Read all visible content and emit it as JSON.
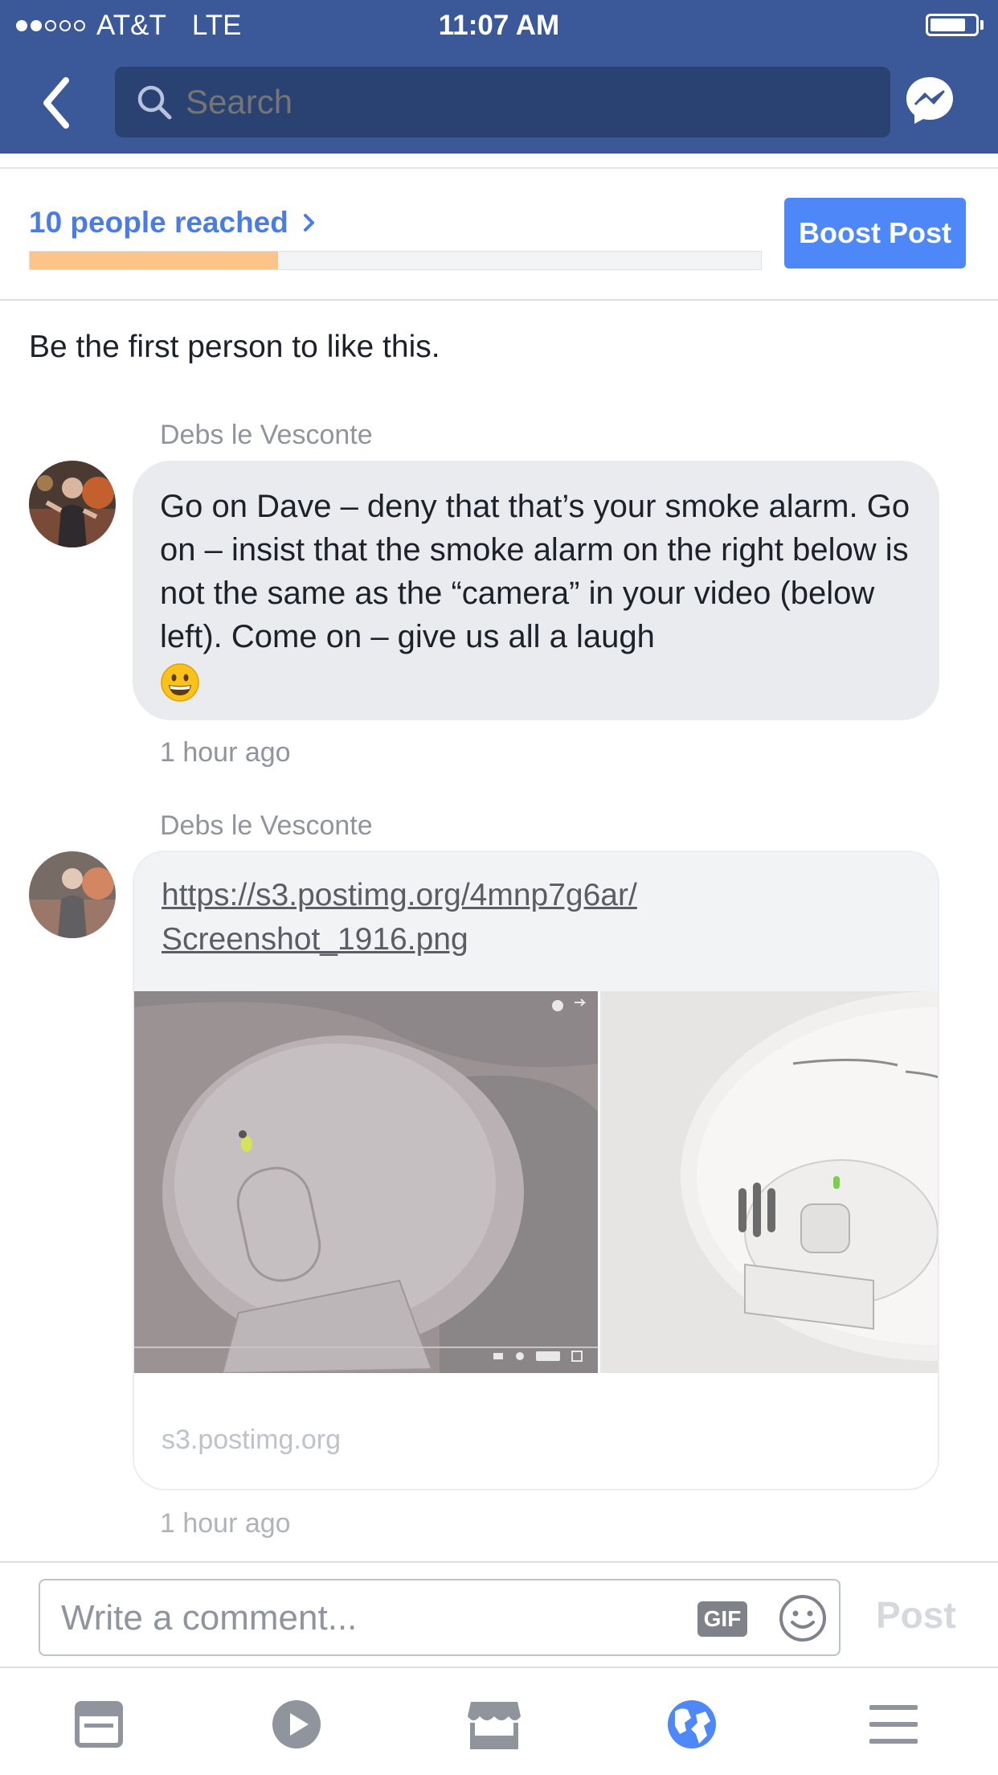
{
  "status_bar": {
    "signal_bars_filled": 2,
    "signal_bars_total": 5,
    "carrier": "AT&T",
    "network": "LTE",
    "time": "11:07 AM",
    "battery_level": 0.8
  },
  "nav": {
    "back_icon": "chevron-left-icon",
    "search_placeholder": "Search",
    "messenger_icon": "messenger-icon"
  },
  "reach": {
    "label": "10 people reached",
    "progress_fraction": 0.34,
    "progress_color": "#fcc489",
    "boost_label": "Boost Post"
  },
  "likes_text": "Be the first person to like this.",
  "comments": [
    {
      "author": "Debs le Vesconte",
      "text": "Go on Dave – deny that that’s your smoke alarm. Go on – insist that the smoke alarm on the right below is not the same as the “camera” in your video (below left). Come on – give us all a laugh",
      "emoji": "grinning-face-emoji",
      "time": "1 hour ago"
    },
    {
      "author": "Debs le Vesconte",
      "link_line1": "https://s3.postimg.org/4mnp7g6ar/",
      "link_line2": "Screenshot_1916.png",
      "domain": "s3.postimg.org",
      "time": "1 hour ago"
    }
  ],
  "composer": {
    "placeholder": "Write a comment...",
    "gif_label": "GIF",
    "post_label": "Post"
  },
  "tabbar": {
    "tabs": [
      "news-feed-icon",
      "video-icon",
      "marketplace-icon",
      "notifications-globe-icon",
      "menu-icon"
    ],
    "active_tab": "notifications-globe-icon"
  },
  "colors": {
    "brand_blue": "#3b5998",
    "boost_blue": "#4e88f8",
    "link_blue": "#4b7ce6",
    "active_tab_blue": "#4e88f8"
  }
}
